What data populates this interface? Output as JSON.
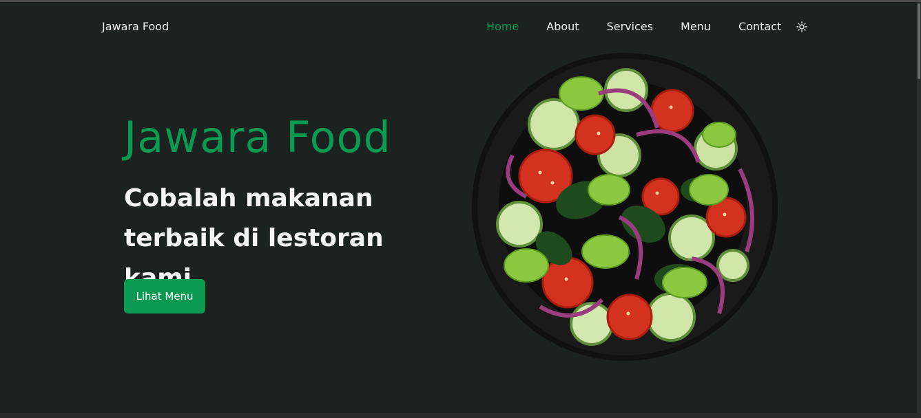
{
  "nav": {
    "brand": "Jawara Food",
    "links": [
      {
        "label": "Home",
        "active": true
      },
      {
        "label": "About",
        "active": false
      },
      {
        "label": "Services",
        "active": false
      },
      {
        "label": "Menu",
        "active": false
      },
      {
        "label": "Contact",
        "active": false
      }
    ],
    "theme_icon": "sun-icon"
  },
  "hero": {
    "title": "Jawara Food",
    "subtitle_line1": "Cobalah makanan",
    "subtitle_line2": "terbaik di lestoran kami.",
    "button_label": "Lihat Menu",
    "image": "salad-bowl-image"
  },
  "colors": {
    "accent": "#0b9a52",
    "background": "#1c2220",
    "text": "#f2f2f2"
  }
}
